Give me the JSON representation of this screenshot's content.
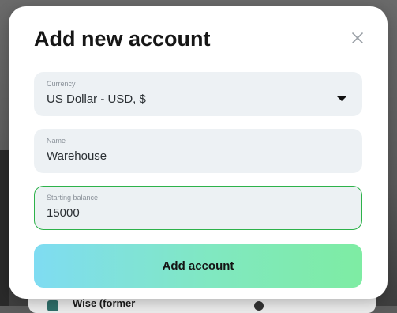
{
  "background": {
    "card_text": "Wise (former"
  },
  "modal": {
    "title": "Add new account",
    "close_icon": "close-icon",
    "fields": {
      "currency": {
        "label": "Currency",
        "value": "US Dollar - USD,  $",
        "icon": "chevron-down-icon"
      },
      "name": {
        "label": "Name",
        "value": "Warehouse"
      },
      "starting_balance": {
        "label": "Starting balance",
        "value": "15000"
      }
    },
    "submit_label": "Add account"
  },
  "colors": {
    "focus_border": "#2db24a",
    "field_background": "#edf1f4",
    "button_gradient_start": "#7fdcf2",
    "button_gradient_end": "#7eeca3"
  }
}
